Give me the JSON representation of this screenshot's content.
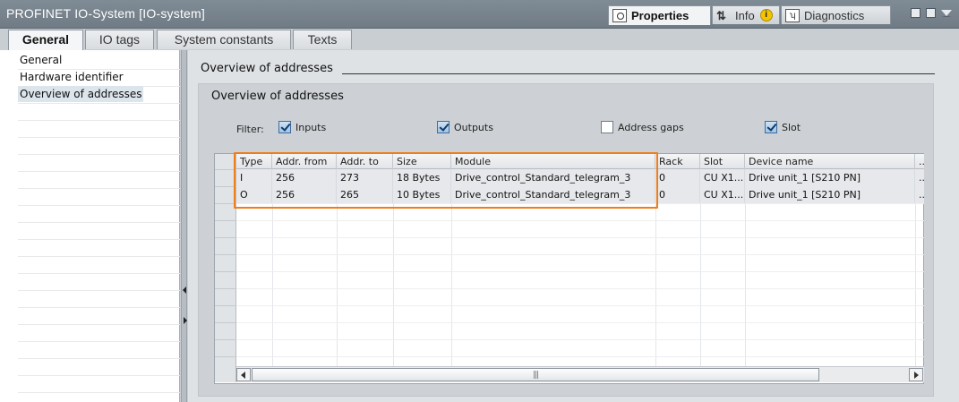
{
  "window": {
    "title": "PROFINET IO-System [IO-system]"
  },
  "inspector_tabs": [
    {
      "label": "Properties",
      "icon": "properties-icon",
      "active": true
    },
    {
      "label": "Info",
      "icon": "info-icon",
      "badge": "i",
      "active": false
    },
    {
      "label": "Diagnostics",
      "icon": "diagnostics-icon",
      "active": false
    }
  ],
  "subtabs": [
    {
      "label": "General",
      "active": true
    },
    {
      "label": "IO tags",
      "active": false
    },
    {
      "label": "System constants",
      "active": false
    },
    {
      "label": "Texts",
      "active": false
    }
  ],
  "nav": {
    "items": [
      {
        "label": "General",
        "selected": false
      },
      {
        "label": "Hardware identifier",
        "selected": false
      },
      {
        "label": "Overview of addresses",
        "selected": true
      }
    ]
  },
  "section": {
    "title": "Overview of addresses",
    "group_title": "Overview of addresses"
  },
  "filter": {
    "label": "Filter:",
    "options": [
      {
        "label": "Inputs",
        "checked": true
      },
      {
        "label": "Outputs",
        "checked": true
      },
      {
        "label": "Address gaps",
        "checked": false
      },
      {
        "label": "Slot",
        "checked": true
      }
    ]
  },
  "table": {
    "columns": [
      "Type",
      "Addr. from",
      "Addr. to",
      "Size",
      "Module",
      "Rack",
      "Slot",
      "Device name",
      "..."
    ],
    "rows": [
      [
        "I",
        "256",
        "273",
        "18 Bytes",
        "Drive_control_Standard_telegram_3",
        "0",
        "CU X1...",
        "Drive unit_1 [S210 PN]",
        "..."
      ],
      [
        "O",
        "256",
        "265",
        "10 Bytes",
        "Drive_control_Standard_telegram_3",
        "0",
        "CU X1...",
        "Drive unit_1 [S210 PN]",
        "..."
      ]
    ]
  },
  "colors": {
    "highlight": "#f07d1a",
    "titlebar": "#7a8590",
    "accent_check": "#3d6d9e"
  }
}
